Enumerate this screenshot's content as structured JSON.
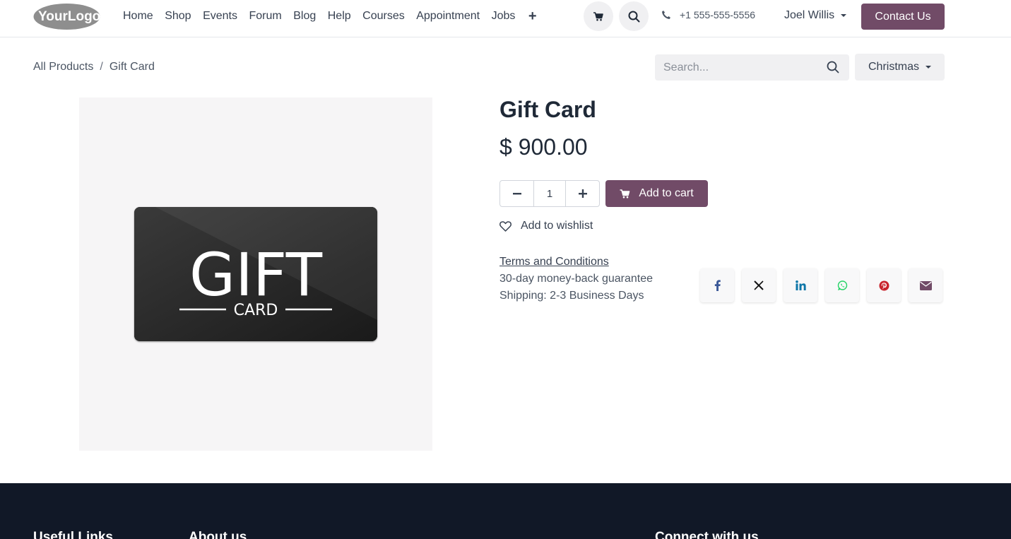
{
  "header": {
    "logo": {
      "text": "YourLogo"
    },
    "nav": [
      "Home",
      "Shop",
      "Events",
      "Forum",
      "Blog",
      "Help",
      "Courses",
      "Appointment",
      "Jobs"
    ],
    "nav_more_icon": "plus-icon",
    "phone": "+1 555-555-5556",
    "user": "Joel Willis",
    "contact_label": "Contact Us"
  },
  "breadcrumb": {
    "parent": "All Products",
    "separator": "/",
    "current": "Gift Card"
  },
  "search": {
    "placeholder": "Search..."
  },
  "pricelist": {
    "selected": "Christmas"
  },
  "product": {
    "name": "Gift Card",
    "price": "$ 900.00",
    "quantity": "1",
    "add_to_cart_label": "Add to cart",
    "wishlist_label": "Add to wishlist",
    "terms_label": "Terms and Conditions",
    "guarantee": "30-day money-back guarantee",
    "shipping": "Shipping: 2-3 Business Days",
    "image_text_main": "GIFT",
    "image_text_sub": "CARD"
  },
  "share_icons": [
    "facebook-icon",
    "x-icon",
    "linkedin-icon",
    "whatsapp-icon",
    "pinterest-icon",
    "email-icon"
  ],
  "footer": {
    "col1": "Useful Links",
    "col2": "About us",
    "col3": "Connect with us"
  },
  "colors": {
    "brand": "#714b67",
    "footer_bg": "#111827",
    "image_bg": "#f6f5f6",
    "facebook": "#3b5998",
    "linkedin": "#0e76a8",
    "whatsapp": "#25d366",
    "pinterest": "#c8232c",
    "email": "#714b67"
  }
}
